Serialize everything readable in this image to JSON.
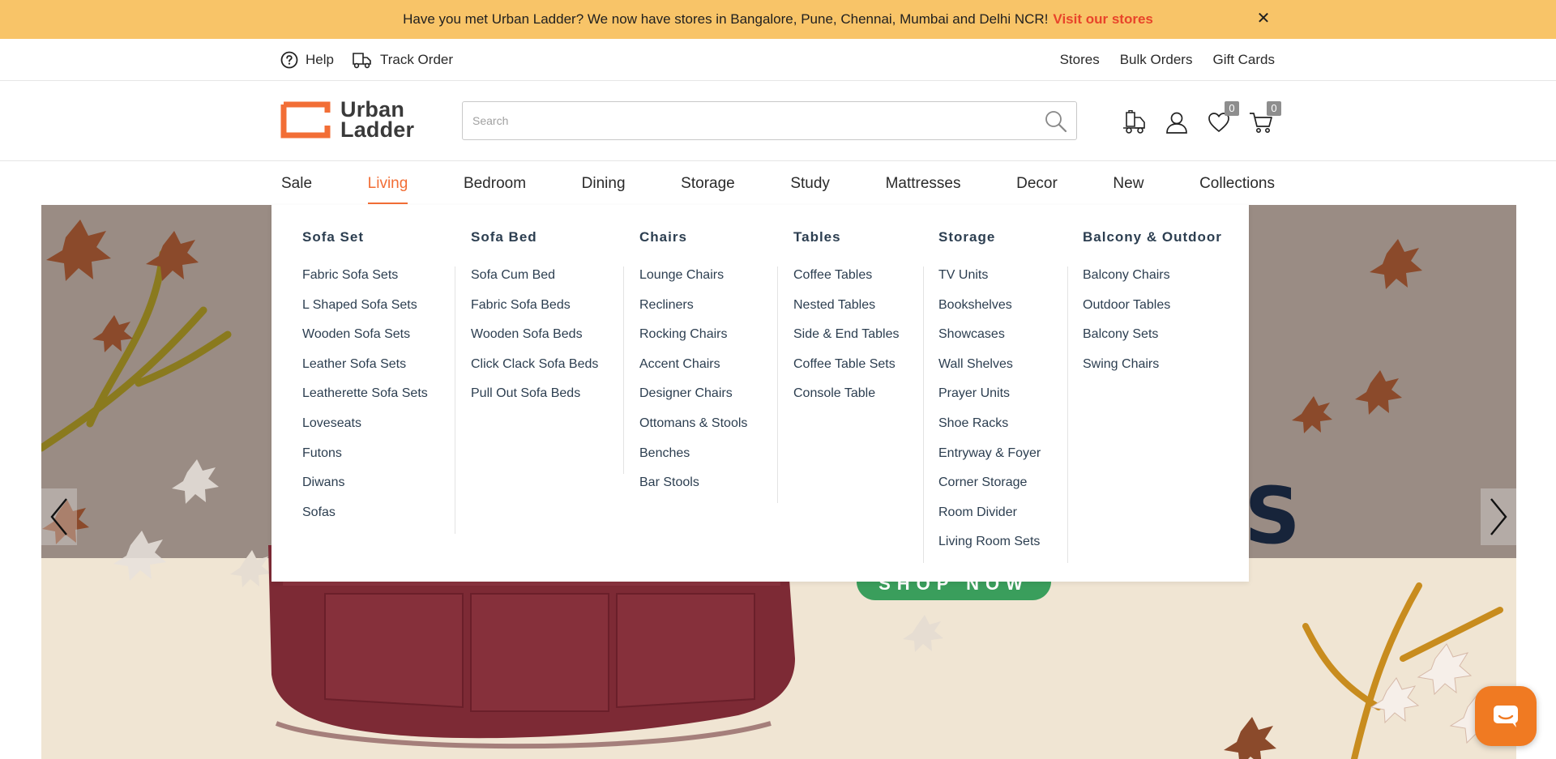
{
  "announcement": {
    "message": "Have you met Urban Ladder? We now have stores in Bangalore, Pune, Chennai, Mumbai and Delhi NCR!",
    "link": "Visit our stores",
    "close_icon": "close-icon"
  },
  "utility_left": [
    {
      "label": "Help",
      "icon": "help-icon"
    },
    {
      "label": "Track Order",
      "icon": "truck-icon"
    }
  ],
  "utility_right": [
    "Stores",
    "Bulk Orders",
    "Gift Cards"
  ],
  "logo": {
    "line1": "Urban",
    "line2": "Ladder",
    "brand_color": "#f26e36"
  },
  "search": {
    "placeholder": "Search",
    "value": ""
  },
  "header_icons": {
    "wishlist_count": "0",
    "cart_count": "0"
  },
  "nav": [
    "Sale",
    "Living",
    "Bedroom",
    "Dining",
    "Storage",
    "Study",
    "Mattresses",
    "Decor",
    "New",
    "Collections"
  ],
  "nav_active": "Living",
  "mega_menu": [
    {
      "heading": "Sofa Set",
      "items": [
        "Fabric Sofa Sets",
        "L Shaped Sofa Sets",
        "Wooden Sofa Sets",
        "Leather Sofa Sets",
        "Leatherette Sofa Sets",
        "Loveseats",
        "Futons",
        "Diwans",
        "Sofas"
      ]
    },
    {
      "heading": "Sofa Bed",
      "items": [
        "Sofa Cum Bed",
        "Fabric Sofa Beds",
        "Wooden Sofa Beds",
        "Click Clack Sofa Beds",
        "Pull Out Sofa Beds"
      ]
    },
    {
      "heading": "Chairs",
      "items": [
        "Lounge Chairs",
        "Recliners",
        "Rocking Chairs",
        "Accent Chairs",
        "Designer Chairs",
        "Ottomans & Stools",
        "Benches",
        "Bar Stools"
      ]
    },
    {
      "heading": "Tables",
      "items": [
        "Coffee Tables",
        "Nested Tables",
        "Side & End Tables",
        "Coffee Table Sets",
        "Console Table"
      ]
    },
    {
      "heading": "Storage",
      "items": [
        "TV Units",
        "Bookshelves",
        "Showcases",
        "Wall Shelves",
        "Prayer Units",
        "Shoe Racks",
        "Entryway & Foyer",
        "Corner Storage",
        "Room Divider",
        "Living Room Sets"
      ]
    },
    {
      "heading": "Balcony & Outdoor",
      "items": [
        "Balcony Chairs",
        "Outdoor Tables",
        "Balcony Sets",
        "Swing Chairs"
      ]
    }
  ],
  "hero": {
    "headline_fragment": ".S",
    "cta": "SHOP NOW"
  },
  "colors": {
    "announcement_bg": "#f8c468",
    "accent": "#f26e36",
    "menu_text": "#2c3e50",
    "cta_green": "#3a9e5c",
    "chat_orange": "#f07a22"
  }
}
